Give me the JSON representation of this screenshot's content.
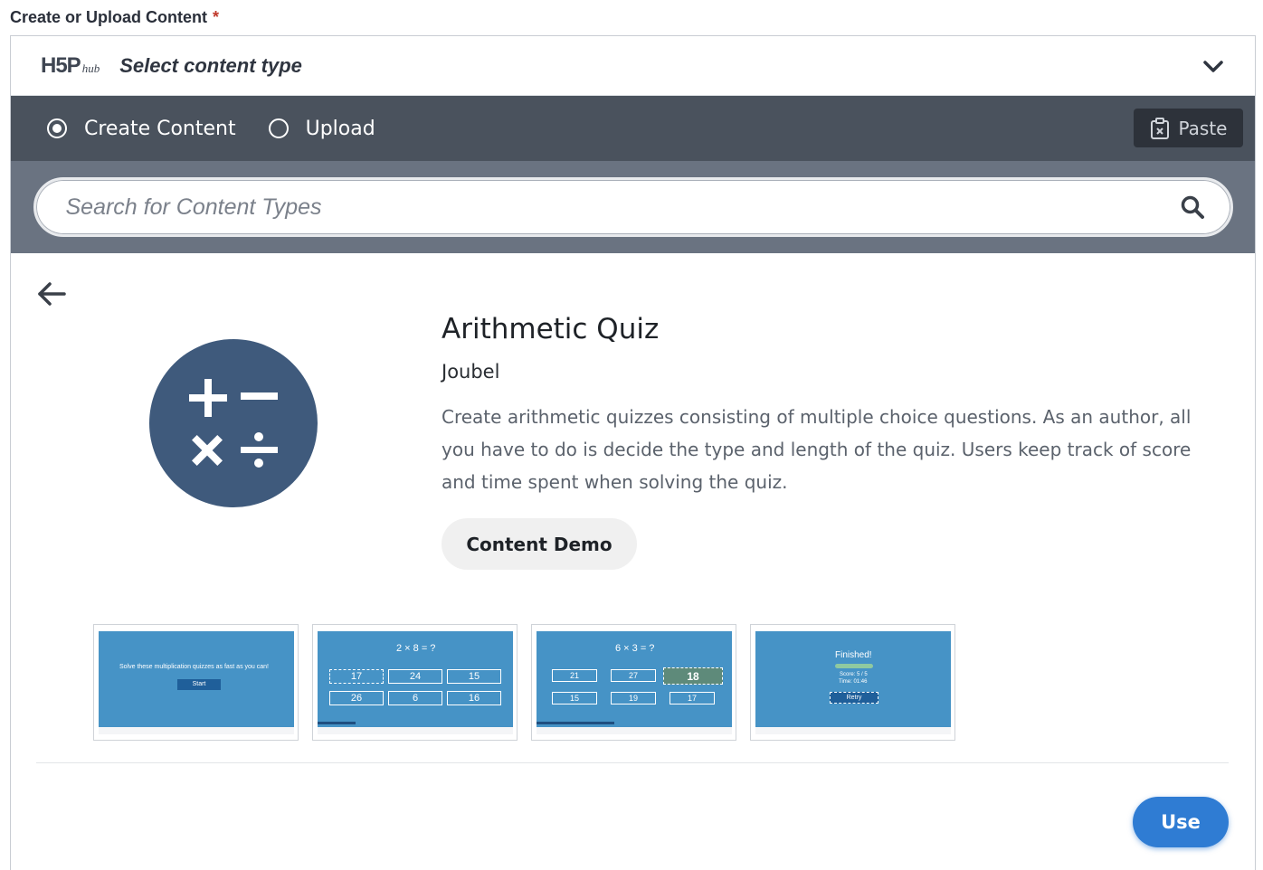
{
  "field": {
    "label": "Create or Upload Content",
    "required_mark": "*"
  },
  "hub_header": {
    "logo_main": "H5P",
    "logo_sub": "hub",
    "title": "Select content type"
  },
  "tabs": {
    "create_label": "Create Content",
    "upload_label": "Upload",
    "selected": "Create Content",
    "paste_label": "Paste"
  },
  "search": {
    "placeholder": "Search for Content Types"
  },
  "detail": {
    "title": "Arithmetic Quiz",
    "owner": "Joubel",
    "description": "Create arithmetic quizzes consisting of multiple choice questions. As an author, all you have to do is decide the type and length of the quiz. Users keep track of score and time spent when solving the quiz.",
    "demo_label": "Content Demo"
  },
  "screenshots": {
    "s1": {
      "text": "Solve these multiplication quizzes as fast as you can!",
      "button": "Start"
    },
    "s2": {
      "question": "2 × 8 = ?",
      "answers": [
        "17",
        "24",
        "15",
        "26",
        "6",
        "16"
      ]
    },
    "s3": {
      "question": "6 × 3 = ?",
      "answers": [
        "21",
        "27",
        "18",
        "15",
        "19",
        "17"
      ]
    },
    "s4": {
      "title": "Finished!",
      "score": "Score: 5 / 5",
      "time": "Time: 01:46",
      "button": "Retry"
    }
  },
  "actions": {
    "use_label": "Use"
  },
  "colors": {
    "accent": "#2f7cd3",
    "tabbar": "#4a525d",
    "search_band": "#6a7381",
    "icon_bg": "#3f5a7c",
    "screenshot_bg": "#4693c6"
  }
}
